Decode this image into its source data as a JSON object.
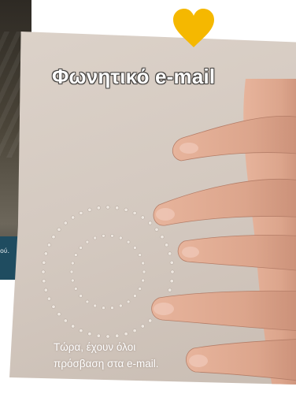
{
  "back_card": {
    "snippet": "ού."
  },
  "leaflet": {
    "title": "Φωνητικό e-mail",
    "tagline_lines": [
      "Τώρα, έχουν όλοι",
      "πρόσβαση στα e-mail."
    ]
  },
  "icons": {
    "heart": "heart-icon"
  },
  "colors": {
    "heart": "#f5b800",
    "paper": "#d8cdc4",
    "title_text": "#ffffff"
  }
}
